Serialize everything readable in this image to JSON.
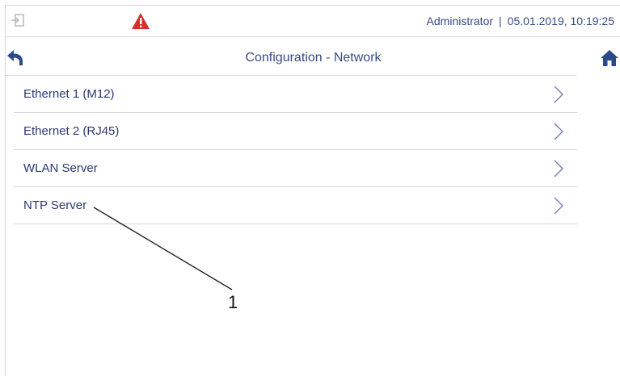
{
  "statusbar": {
    "user": "Administrator",
    "separator": "|",
    "datetime": "05.01.2019, 10:19:25",
    "login_icon": "login-icon",
    "warning_icon": "warning-icon"
  },
  "navbar": {
    "title": "Configuration - Network",
    "back_icon": "back-icon",
    "home_icon": "home-icon"
  },
  "menu": {
    "items": [
      {
        "label": "Ethernet 1 (M12)"
      },
      {
        "label": "Ethernet 2 (RJ45)"
      },
      {
        "label": "WLAN Server"
      },
      {
        "label": "NTP Server"
      }
    ]
  },
  "callout": {
    "number": "1"
  },
  "colors": {
    "text": "#2b3a73",
    "accent": "#2b4a8a",
    "warning": "#d32f2f",
    "divider": "#d6d6d6"
  }
}
